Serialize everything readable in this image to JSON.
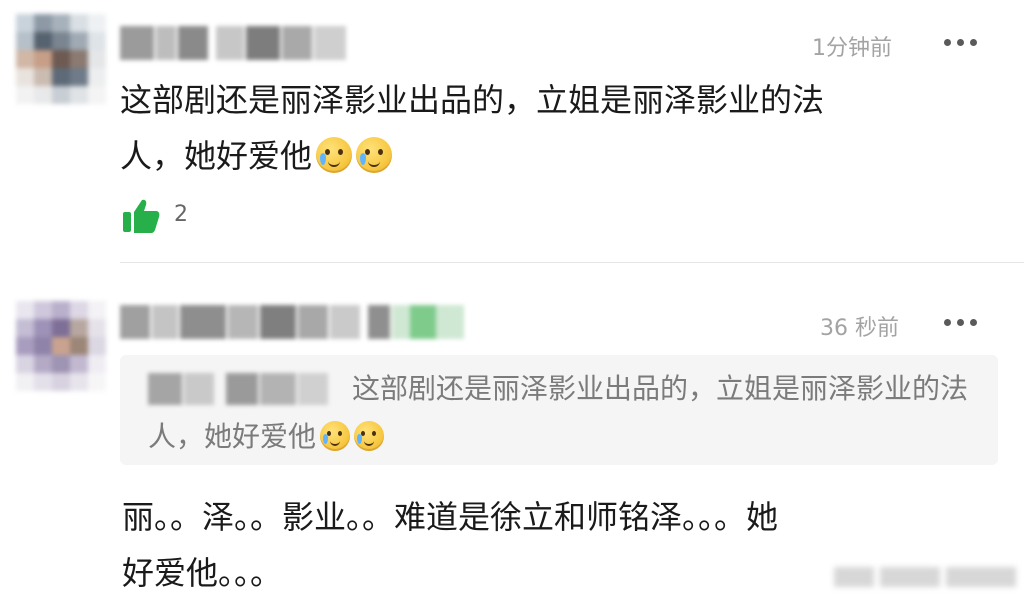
{
  "comments": [
    {
      "time": "1分钟前",
      "text_lines": [
        "这部剧还是丽泽影业出品的，立姐是丽泽影业的法",
        "人，她好爱他"
      ],
      "emoji": [
        "crying-smile-emoji",
        "crying-smile-emoji"
      ],
      "like_count": "2"
    },
    {
      "time": "36 秒前",
      "quote": {
        "text": "这部剧还是丽泽影业出品的，立姐是丽泽影业的法人，她好爱他",
        "emoji": [
          "crying-smile-emoji",
          "crying-smile-emoji"
        ]
      },
      "text_lines": [
        "丽。。泽。。影业。。难道是徐立和师铭泽。。。她",
        "好爱他。。。"
      ]
    }
  ],
  "colors": {
    "like_green": "#27b04a",
    "time_gray": "#a3a3a3",
    "quote_bg": "#f5f5f5"
  },
  "icons": {
    "more": "more-dots-icon",
    "like": "thumbs-up-icon"
  }
}
